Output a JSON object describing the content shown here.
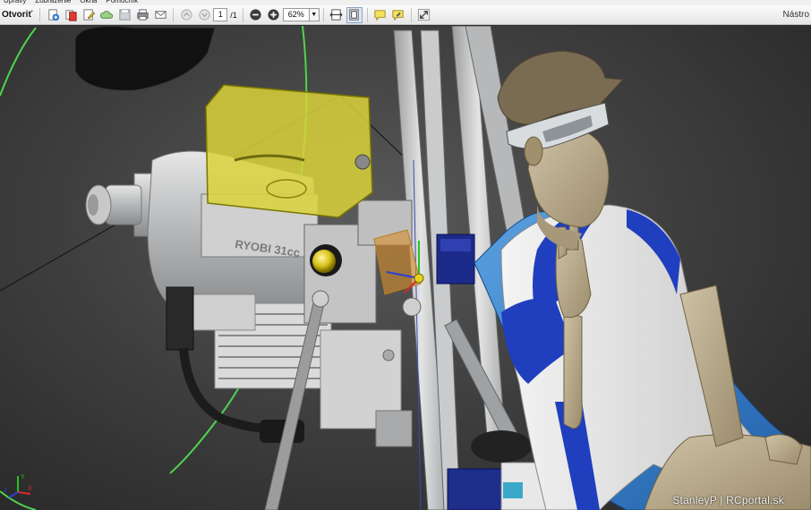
{
  "menu": {
    "items": [
      "Úpravy",
      "Zobrazenie",
      "Okná",
      "Pomocník"
    ]
  },
  "toolbar": {
    "open_label": "Otvoriť",
    "page_current": "1",
    "page_total": "/1",
    "zoom_value": "62%",
    "tools_label": "Nástro"
  },
  "viewport": {
    "engine_label": "RYOBI 31cc",
    "watermark": "StanleyP | RCportal.sk"
  },
  "colors": {
    "toolbar_bg": "#ececec",
    "viewport_bg": "#404040",
    "tank_yellow": "#d9d23a",
    "pilot_blue": "#1f3fbf",
    "seat_blue": "#2f7fd0",
    "skin": "#b3a384",
    "frame_gray": "#bfc2c4",
    "green_arc": "#4fd34f"
  }
}
